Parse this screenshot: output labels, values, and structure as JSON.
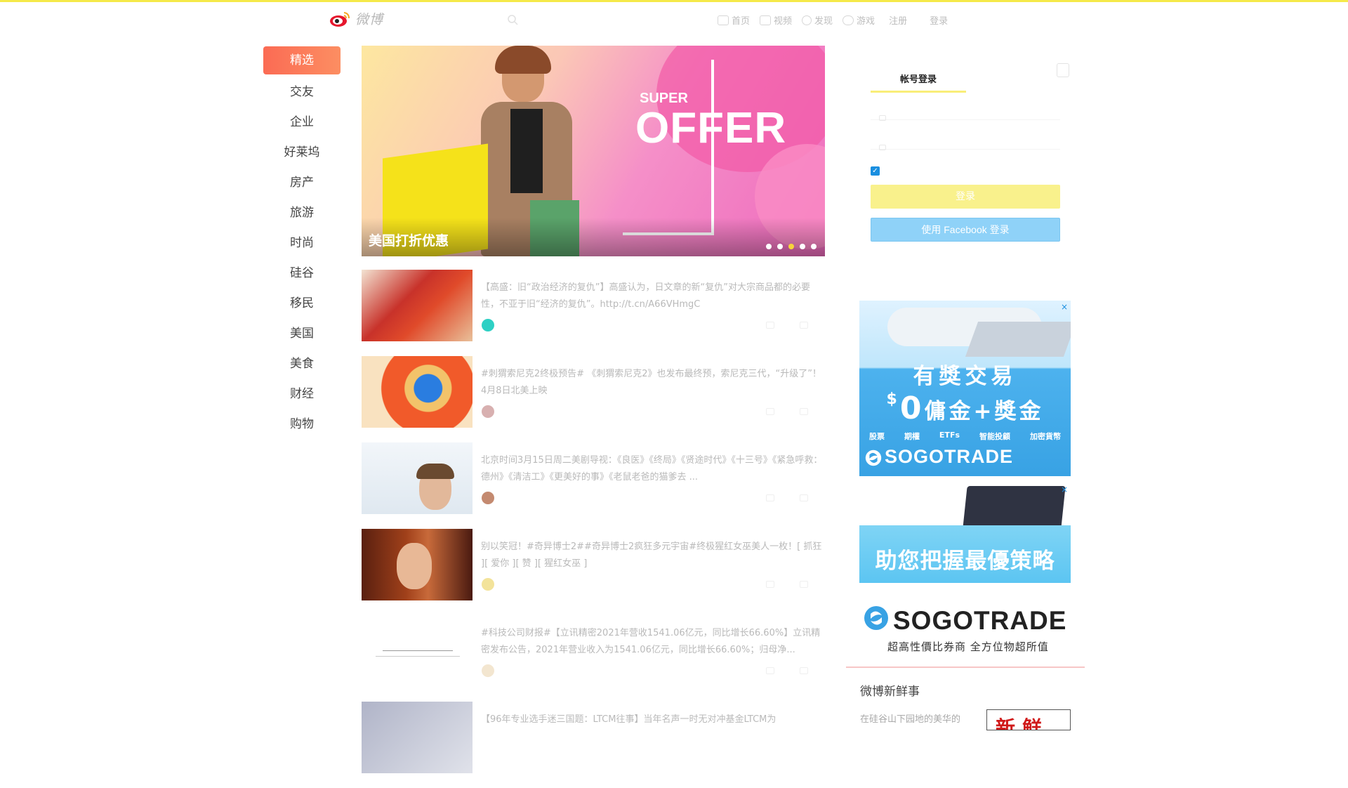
{
  "brand": {
    "name": "微博"
  },
  "nav": {
    "items": [
      {
        "label": "首页",
        "icon": "home-icon"
      },
      {
        "label": "视频",
        "icon": "video-icon"
      },
      {
        "label": "发现",
        "icon": "discover-icon"
      },
      {
        "label": "游戏",
        "icon": "game-icon"
      },
      {
        "label": "注册"
      },
      {
        "label": "登录"
      }
    ]
  },
  "sidebar": {
    "items": [
      {
        "label": "精选",
        "active": true
      },
      {
        "label": "交友"
      },
      {
        "label": "企业"
      },
      {
        "label": "好莱坞"
      },
      {
        "label": "房产"
      },
      {
        "label": "旅游"
      },
      {
        "label": "时尚"
      },
      {
        "label": "硅谷"
      },
      {
        "label": "移民"
      },
      {
        "label": "美国"
      },
      {
        "label": "美食"
      },
      {
        "label": "财经"
      },
      {
        "label": "购物"
      }
    ]
  },
  "banner": {
    "super": "SUPER",
    "offer": "OFFER",
    "caption": "美国打折优惠",
    "slide_count": 5,
    "active_slide": 3
  },
  "feed": {
    "items": [
      {
        "text": "【高盛：旧“政治经济的复仇”】高盛认为，日文章的新“复仇”对大宗商品都的必要性，不亚于旧“经济的复仇”。http://t.cn/A66VHmgC",
        "thumb": "armor-hero"
      },
      {
        "text": "#刺猬索尼克2终极预告# 《刺猬索尼克2》也发布最终预，索尼克三代，“升级了”！4月8日北美上映",
        "thumb": "sonic"
      },
      {
        "text": "北京时间3月15日周二美剧导视：《良医》《终局》《贤途时代》《十三号》《紧急呼救：德州》《清洁工》《更美好的事》《老鼠老爸的猫爹去 ...",
        "thumb": "good-doctor"
      },
      {
        "text": "别以笑冠！#奇异博士2##奇异博士2疯狂多元宇宙#终极猩红女巫美人一枚！[ 抓狂 ][ 爱你 ][ 赞 ][ 猩红女巫 ]",
        "thumb": "scarlet-witch"
      },
      {
        "text": "#科技公司财报#【立讯精密2021年营收1541.06亿元，同比增长66.60%】立讯精密发布公告，2021年营业收入为1541.06亿元，同比增长66.60%；归母净...",
        "thumb": "report"
      },
      {
        "text": "【96年专业选手迷三国题：LTCM往事】当年名声一时无对冲基金LTCM为",
        "thumb": "ltcm"
      }
    ]
  },
  "login": {
    "tab_label": "帐号登录",
    "remember_checked": true,
    "login_button": "登录",
    "facebook_button": "使用 Facebook 登录"
  },
  "ads": {
    "ad1": {
      "line1": "有獎交易",
      "line2_prefix": "$",
      "line2_zero": "0",
      "line2_rest": "傭金+獎金",
      "categories": [
        "股票",
        "期權",
        "ETFs",
        "智能投顧",
        "加密貨幣"
      ],
      "brand": "SOGOTRADE",
      "close": "×"
    },
    "ad2": {
      "headline": "助您把握最優策略",
      "brand": "SOGOTRADE",
      "tagline": "超高性價比券商 全方位物超所值",
      "close": "×"
    }
  },
  "fresh": {
    "title": "微博新鲜事",
    "text": "在硅谷山下园地的美华的",
    "box_text": "新鲜"
  },
  "colors": {
    "accent": "#fb6b54",
    "login_yellow": "#f9f18c",
    "facebook_blue": "#8fd2f8",
    "ad_blue": "#38a2e4",
    "top_line": "#f5e94a"
  }
}
